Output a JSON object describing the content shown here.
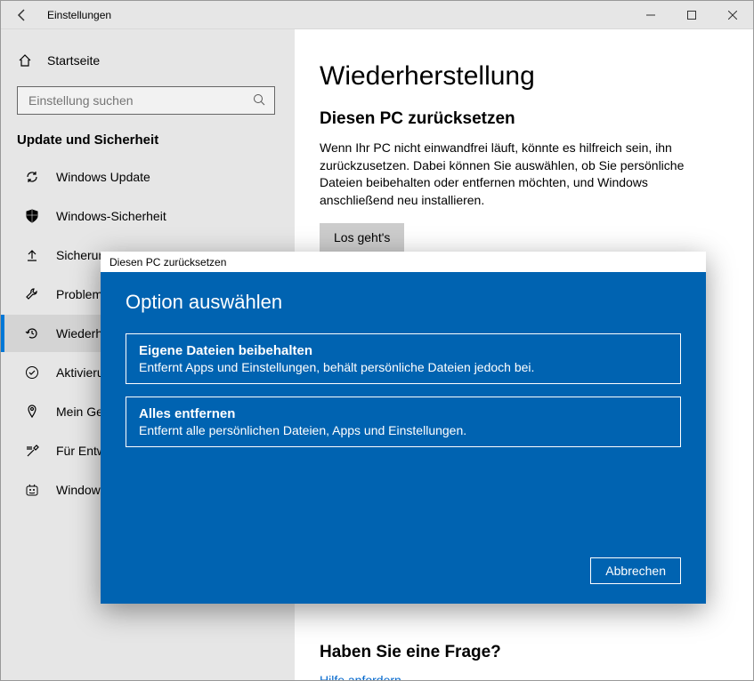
{
  "window": {
    "title": "Einstellungen"
  },
  "sidebar": {
    "home": "Startseite",
    "search_placeholder": "Einstellung suchen",
    "section": "Update und Sicherheit",
    "items": [
      {
        "label": "Windows Update"
      },
      {
        "label": "Windows-Sicherheit"
      },
      {
        "label": "Sicherung"
      },
      {
        "label": "Problembehandlung"
      },
      {
        "label": "Wiederherstellung"
      },
      {
        "label": "Aktivierung"
      },
      {
        "label": "Mein Gerät suchen"
      },
      {
        "label": "Für Entwickler"
      },
      {
        "label": "Windows-Insider-Programm"
      }
    ]
  },
  "main": {
    "heading": "Wiederherstellung",
    "reset_heading": "Diesen PC zurücksetzen",
    "reset_desc": "Wenn Ihr PC nicht einwandfrei läuft, könnte es hilfreich sein, ihn zurückzusetzen. Dabei können Sie auswählen, ob Sie persönliche Dateien beibehalten oder entfernen möchten, und Windows anschließend neu installieren.",
    "reset_button": "Los geht's",
    "question_heading": "Haben Sie eine Frage?",
    "help_link": "Hilfe anfordern"
  },
  "modal": {
    "title": "Diesen PC zurücksetzen",
    "heading": "Option auswählen",
    "options": [
      {
        "title": "Eigene Dateien beibehalten",
        "desc": "Entfernt Apps und Einstellungen, behält persönliche Dateien jedoch bei."
      },
      {
        "title": "Alles entfernen",
        "desc": "Entfernt alle persönlichen Dateien, Apps und Einstellungen."
      }
    ],
    "cancel": "Abbrechen"
  }
}
